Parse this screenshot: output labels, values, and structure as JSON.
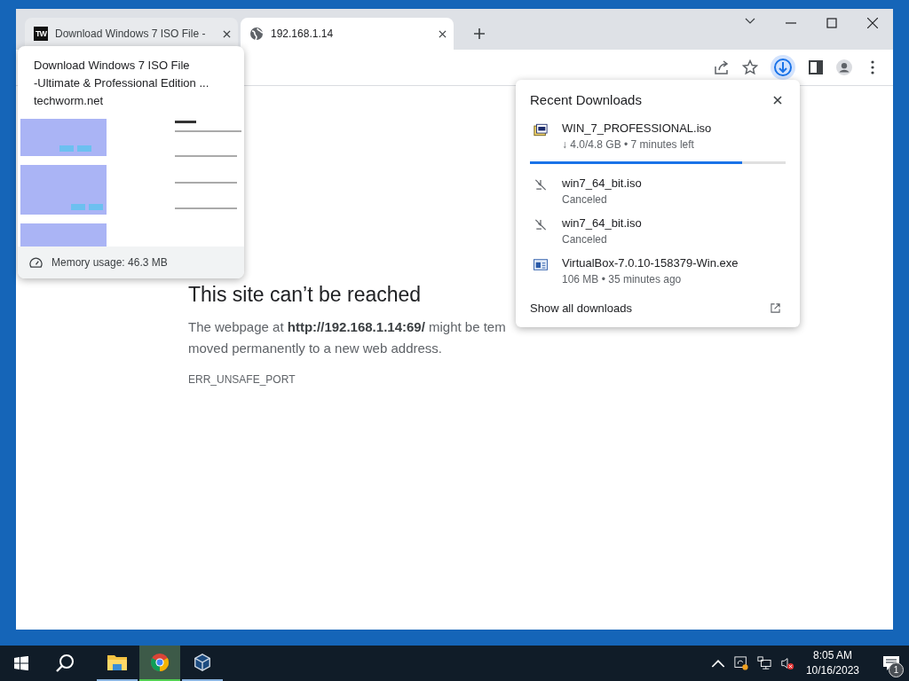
{
  "tabs": [
    {
      "title": "Download Windows 7 ISO File -",
      "logo": "TW",
      "selected": false
    },
    {
      "title": "192.168.1.14",
      "selected": true
    }
  ],
  "hover_card": {
    "title_lines": [
      "Download Windows 7 ISO File",
      "-Ultimate & Professional Edition ..."
    ],
    "domain": "techworm.net",
    "thumbnail": {
      "kind": "picture"
    },
    "memory": "Memory usage: 46.3 MB"
  },
  "toolbar": {
    "downloads_button": {
      "selected": true
    }
  },
  "page": {
    "heading": "This site can’t be reached",
    "lines": [
      "The webpage at **http://192.168.1.14:69/** might be tem",
      "moved permanently to a new web address."
    ],
    "code": "ERR_UNSAFE_PORT"
  },
  "downloads": {
    "title": "Recent Downloads",
    "items": [
      {
        "kind": "in_progress",
        "name": "WIN_7_PROFESSIONAL.iso",
        "status": "↓ 4.0/4.8 GB • 7 minutes left",
        "level": 0.83
      },
      {
        "kind": "canceled",
        "name": "win7_64_bit.iso",
        "status": "Canceled"
      },
      {
        "kind": "canceled",
        "name": "win7_64_bit.iso",
        "status": "Canceled"
      },
      {
        "kind": "complete",
        "name": "VirtualBox-7.0.10-158379-Win.exe",
        "status": "106 MB • 35 minutes ago"
      }
    ],
    "show_all": "Show all downloads"
  },
  "taskbar": {
    "apps": [
      {
        "kind": "explorer",
        "selected": false
      },
      {
        "kind": "chrome",
        "selected": true
      },
      {
        "kind": "virtualbox",
        "selected": false
      }
    ],
    "time": "8:05 AM",
    "date": "10/16/2023",
    "notifications": "1"
  }
}
